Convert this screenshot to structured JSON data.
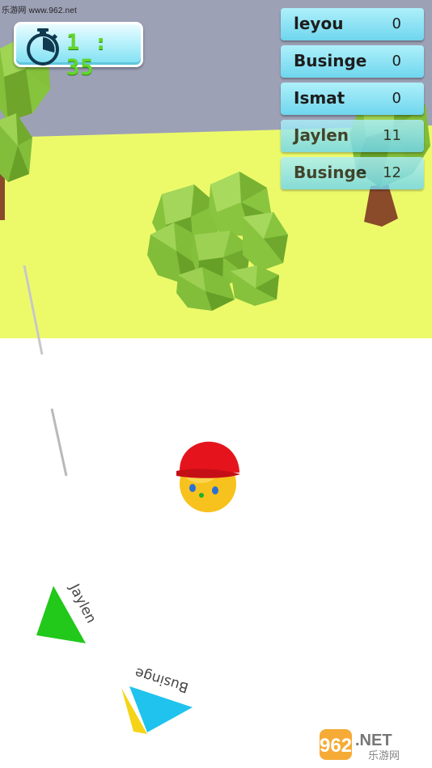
{
  "watermark_top": "乐游网 www.962.net",
  "timer": {
    "minutes": "1",
    "separator": ":",
    "seconds": "35",
    "icon": "stopwatch-icon"
  },
  "scoreboard": [
    {
      "name": "leyou",
      "score": "0"
    },
    {
      "name": "Businge",
      "score": "0"
    },
    {
      "name": "Ismat",
      "score": "0"
    },
    {
      "name": "Jaylen",
      "score": "11"
    },
    {
      "name": "Businge",
      "score": "12"
    }
  ],
  "player_pointers": [
    {
      "label": "Jaylen",
      "color": "#22c81a"
    },
    {
      "label": "Businge",
      "color": "#1fc3ee"
    }
  ],
  "watermark_bottom": {
    "brand": "962",
    "suffix": ".NET",
    "site": "乐游网"
  },
  "colors": {
    "sky": "#9da1b6",
    "field": "#ecfa6a",
    "floor": "#ffffff",
    "foliage": "#8cc63f",
    "player_body": "#f7c21d",
    "player_cap": "#e5141c"
  }
}
